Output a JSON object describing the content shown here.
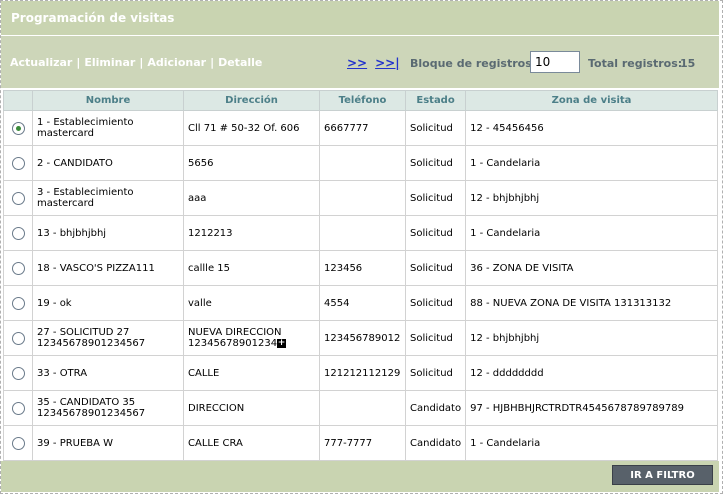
{
  "header": {
    "title": "Programación de visitas"
  },
  "toolbar": {
    "actions": [
      "Actualizar",
      "Eliminar",
      "Adicionar",
      "Detalle"
    ],
    "pager_next": ">>",
    "pager_last": ">>|",
    "block_label": "Bloque de registros:",
    "block_value": "10",
    "total_label": "Total registros:",
    "total_value": "15"
  },
  "table": {
    "columns": [
      "",
      "Nombre",
      "Dirección",
      "Teléfono",
      "Estado",
      "Zona de visita"
    ],
    "rows": [
      {
        "selected": true,
        "nombre": "1 - Establecimiento mastercard",
        "direccion": "Cll 71 # 50-32 Of. 606",
        "telefono": "6667777",
        "estado": "Solicitud",
        "zona": "12 - 45456456"
      },
      {
        "selected": false,
        "nombre": "2 - CANDIDATO",
        "direccion": "5656",
        "telefono": "",
        "estado": "Solicitud",
        "zona": "1 - Candelaria"
      },
      {
        "selected": false,
        "nombre": "3 - Establecimiento mastercard",
        "direccion": "aaa",
        "telefono": "",
        "estado": "Solicitud",
        "zona": "12 - bhjbhjbhj"
      },
      {
        "selected": false,
        "nombre": "13 - bhjbhjbhj",
        "direccion": "1212213",
        "telefono": "",
        "estado": "Solicitud",
        "zona": "1 - Candelaria"
      },
      {
        "selected": false,
        "nombre": "18 - VASCO'S PIZZA111",
        "direccion": "callle 15",
        "telefono": "123456",
        "estado": "Solicitud",
        "zona": "36 - ZONA DE VISITA"
      },
      {
        "selected": false,
        "nombre": "19 - ok",
        "direccion": "valle",
        "telefono": "4554",
        "estado": "Solicitud",
        "zona": "88 - NUEVA ZONA DE VISITA 131313132"
      },
      {
        "selected": false,
        "nombre": "27 - SOLICITUD 27 12345678901234567",
        "direccion": "NUEVA DIRECCION 12345678901234",
        "telefono": "123456789012",
        "estado": "Solicitud",
        "zona": "12 - bhjbhjbhj",
        "expand": true
      },
      {
        "selected": false,
        "nombre": "33 - OTRA",
        "direccion": "CALLE",
        "telefono": "121212112129",
        "estado": "Solicitud",
        "zona": "12 - dddddddd"
      },
      {
        "selected": false,
        "nombre": "35 - CANDIDATO 35 12345678901234567",
        "direccion": "DIRECCION",
        "telefono": "",
        "estado": "Candidato",
        "zona": "97 - HJBHBHJRCTRDTR4545678789789789"
      },
      {
        "selected": false,
        "nombre": "39 - PRUEBA W",
        "direccion": "CALLE CRA",
        "telefono": "777-7777",
        "estado": "Candidato",
        "zona": "1 - Candelaria"
      }
    ]
  },
  "footer": {
    "filter_button": "IR A FILTRO"
  }
}
